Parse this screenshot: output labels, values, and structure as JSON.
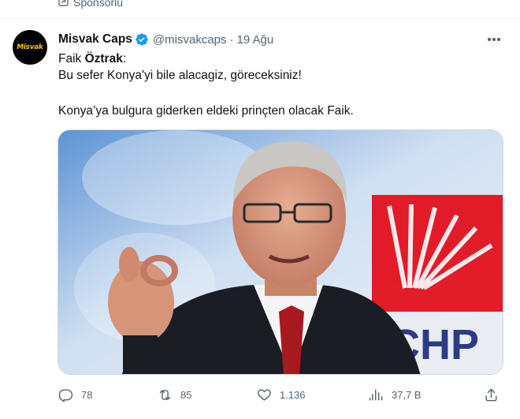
{
  "sponsored": {
    "label": "Sponsorlu"
  },
  "tweet": {
    "author": {
      "name": "Misvak Caps",
      "handle": "@misvakcaps",
      "verified": true,
      "avatar_text": "Misvak"
    },
    "separator": "·",
    "date": "19 Ağu",
    "lines": {
      "l1_prefix": "Faik ",
      "l1_bold": "Öztrak",
      "l1_suffix": ":",
      "l2": "Bu sefer Konya'yi bile alacagiz, göreceksiniz!",
      "l3": "Konya’ya bulgura giderken eldeki prinçten olacak Faik."
    },
    "image": {
      "sign_text": "CHP"
    },
    "stats": {
      "replies": "78",
      "retweets": "85",
      "likes": "1.136",
      "views": "37,7 B"
    }
  },
  "colors": {
    "text_primary": "#0f1419",
    "text_secondary": "#536471",
    "verified": "#1d9bf0",
    "chp_red": "#e30a17"
  },
  "icons": [
    "ad-icon",
    "verified-badge-icon",
    "more-icon",
    "reply-icon",
    "retweet-icon",
    "like-icon",
    "views-icon",
    "share-icon"
  ]
}
